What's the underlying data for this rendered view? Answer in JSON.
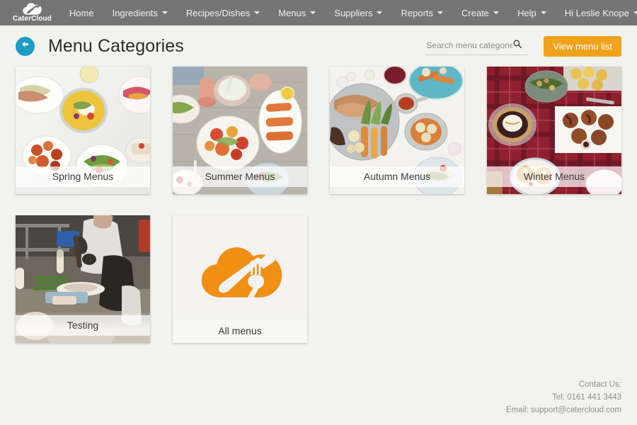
{
  "nav": {
    "brand": {
      "name": "CaterCloud",
      "icon": "catercloud-cloud-logo"
    },
    "items": [
      {
        "label": "Home",
        "caret": false
      },
      {
        "label": "Ingredients",
        "caret": true
      },
      {
        "label": "Recipes/Dishes",
        "caret": true
      },
      {
        "label": "Menus",
        "caret": true
      },
      {
        "label": "Suppliers",
        "caret": true
      },
      {
        "label": "Reports",
        "caret": true
      },
      {
        "label": "Create",
        "caret": true
      }
    ],
    "right_items": [
      {
        "label": "Help",
        "caret": true
      },
      {
        "label": "Hi Leslie Knope",
        "caret": true
      }
    ]
  },
  "header": {
    "back_icon": "back-arrow-icon",
    "title": "Menu Categories",
    "search": {
      "placeholder": "Search menu categories",
      "value": "",
      "icon": "search-icon"
    },
    "view_menu_button": "View menu list"
  },
  "cards": [
    {
      "label": "Spring Menus",
      "image": "spring-food-flatlay",
      "type": "photo"
    },
    {
      "label": "Summer Menus",
      "image": "summer-food-flatlay",
      "type": "photo"
    },
    {
      "label": "Autumn Menus",
      "image": "autumn-food-flatlay",
      "type": "photo"
    },
    {
      "label": "Winter Menus",
      "image": "winter-food-flatlay",
      "type": "photo"
    },
    {
      "label": "Testing",
      "image": "chef-kitchen-photo",
      "type": "photo"
    },
    {
      "label": "All menus",
      "image": "catercloud-cloud-logo",
      "type": "logo"
    }
  ],
  "footer": {
    "contact_label": "Contact Us:",
    "tel": "Tel: 0161 441 3443",
    "email": "Email: support@catercloud.com"
  },
  "colors": {
    "navbar": "#757575",
    "accent_orange": "#f0a11e",
    "back_button_blue": "#1b9dc4",
    "page_background": "#f2f2ee"
  }
}
